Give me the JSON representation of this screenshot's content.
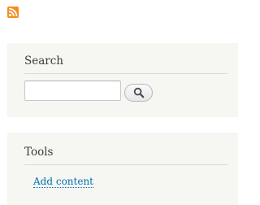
{
  "feed": {
    "icon": "rss-feed-icon",
    "color": "#f68c21"
  },
  "search_block": {
    "title": "Search",
    "input_value": "",
    "button_icon": "magnifier-icon"
  },
  "tools_block": {
    "title": "Tools",
    "links": [
      {
        "label": "Add content"
      }
    ]
  },
  "colors": {
    "block_background": "#f6f6f2",
    "link": "#0071b3",
    "title_text": "#3b3b3b"
  }
}
